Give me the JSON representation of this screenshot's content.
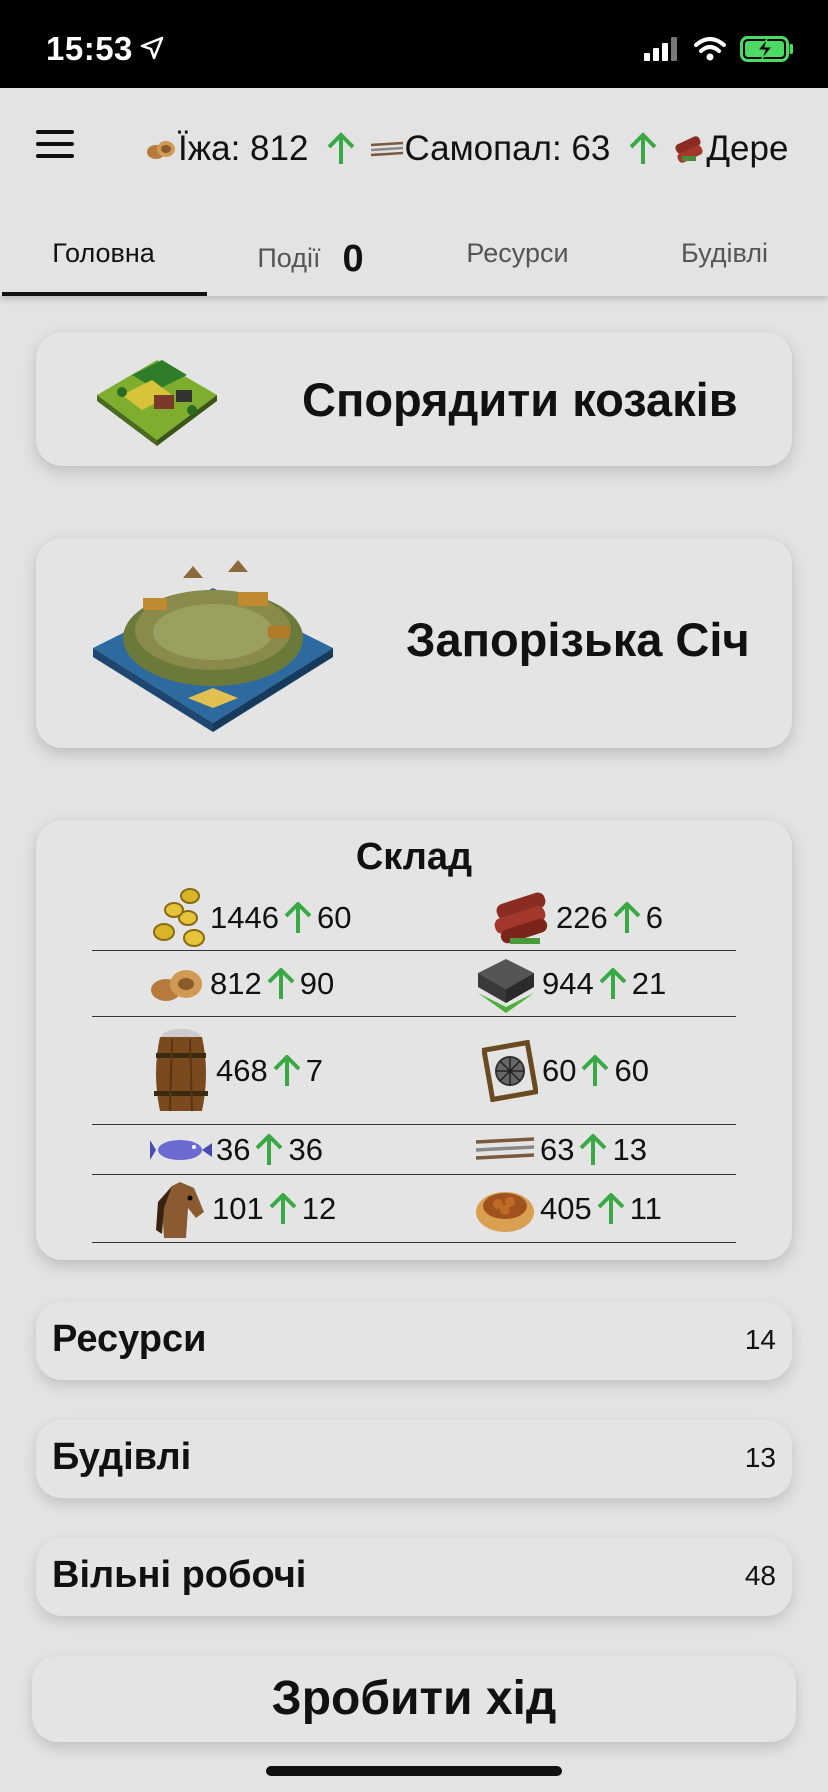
{
  "status_bar": {
    "time": "15:53"
  },
  "ticker": [
    {
      "label": "Їжа: 812",
      "icon": "food-icon"
    },
    {
      "label": "Самопал: 63",
      "icon": "musket-icon"
    },
    {
      "label": "Дере",
      "icon": "wood-icon"
    }
  ],
  "tabs": [
    {
      "label": "Головна"
    },
    {
      "label": "Події",
      "count": "0"
    },
    {
      "label": "Ресурси"
    },
    {
      "label": "Будівлі"
    }
  ],
  "actions": {
    "equip_cossacks": "Спорядити козаків",
    "sich": "Запорізька Січ"
  },
  "storage": {
    "title": "Склад",
    "rows": [
      {
        "left": {
          "icon": "gold-coins-icon",
          "value": "1446",
          "delta": "60"
        },
        "right": {
          "icon": "wood-logs-icon",
          "value": "226",
          "delta": "6"
        }
      },
      {
        "left": {
          "icon": "food-icon",
          "value": "812",
          "delta": "90"
        },
        "right": {
          "icon": "stone-icon",
          "value": "944",
          "delta": "21"
        }
      },
      {
        "left": {
          "icon": "barrel-icon",
          "value": "468",
          "delta": "7"
        },
        "right": {
          "icon": "tanning-frame-icon",
          "value": "60",
          "delta": "60"
        }
      },
      {
        "left": {
          "icon": "fish-icon",
          "value": "36",
          "delta": "36"
        },
        "right": {
          "icon": "musket-icon",
          "value": "63",
          "delta": "13"
        }
      },
      {
        "left": {
          "icon": "horse-icon",
          "value": "101",
          "delta": "12"
        },
        "right": {
          "icon": "bread-basket-icon",
          "value": "405",
          "delta": "11"
        }
      }
    ]
  },
  "sections": [
    {
      "label": "Ресурси",
      "count": "14"
    },
    {
      "label": "Будівлі",
      "count": "13"
    },
    {
      "label": "Вільні робочі",
      "count": "48"
    }
  ],
  "turn_button": "Зробити хід",
  "colors": {
    "arrow_up": "#3aa845",
    "background": "#e3e3e3",
    "battery": "#4cd964"
  }
}
